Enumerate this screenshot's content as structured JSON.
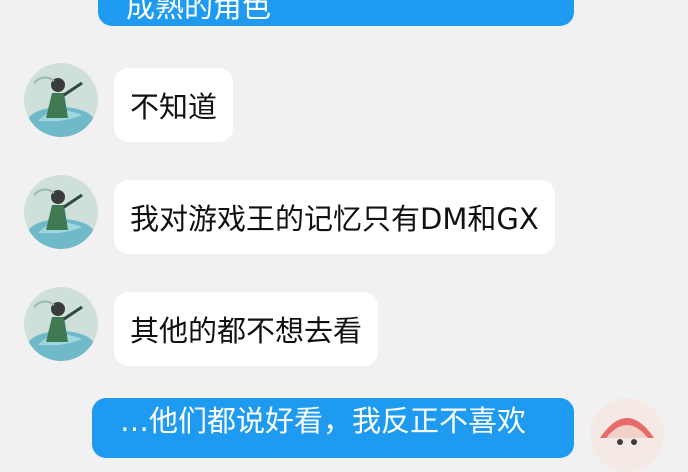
{
  "messages": [
    {
      "side": "out",
      "text": "成熟的角色"
    },
    {
      "side": "in",
      "text": "不知道"
    },
    {
      "side": "in",
      "text": "我对游戏王的记忆只有DM和GX"
    },
    {
      "side": "in",
      "text": "其他的都不想去看"
    },
    {
      "side": "out",
      "text": "…他们都说好看，我反正不喜欢"
    }
  ]
}
